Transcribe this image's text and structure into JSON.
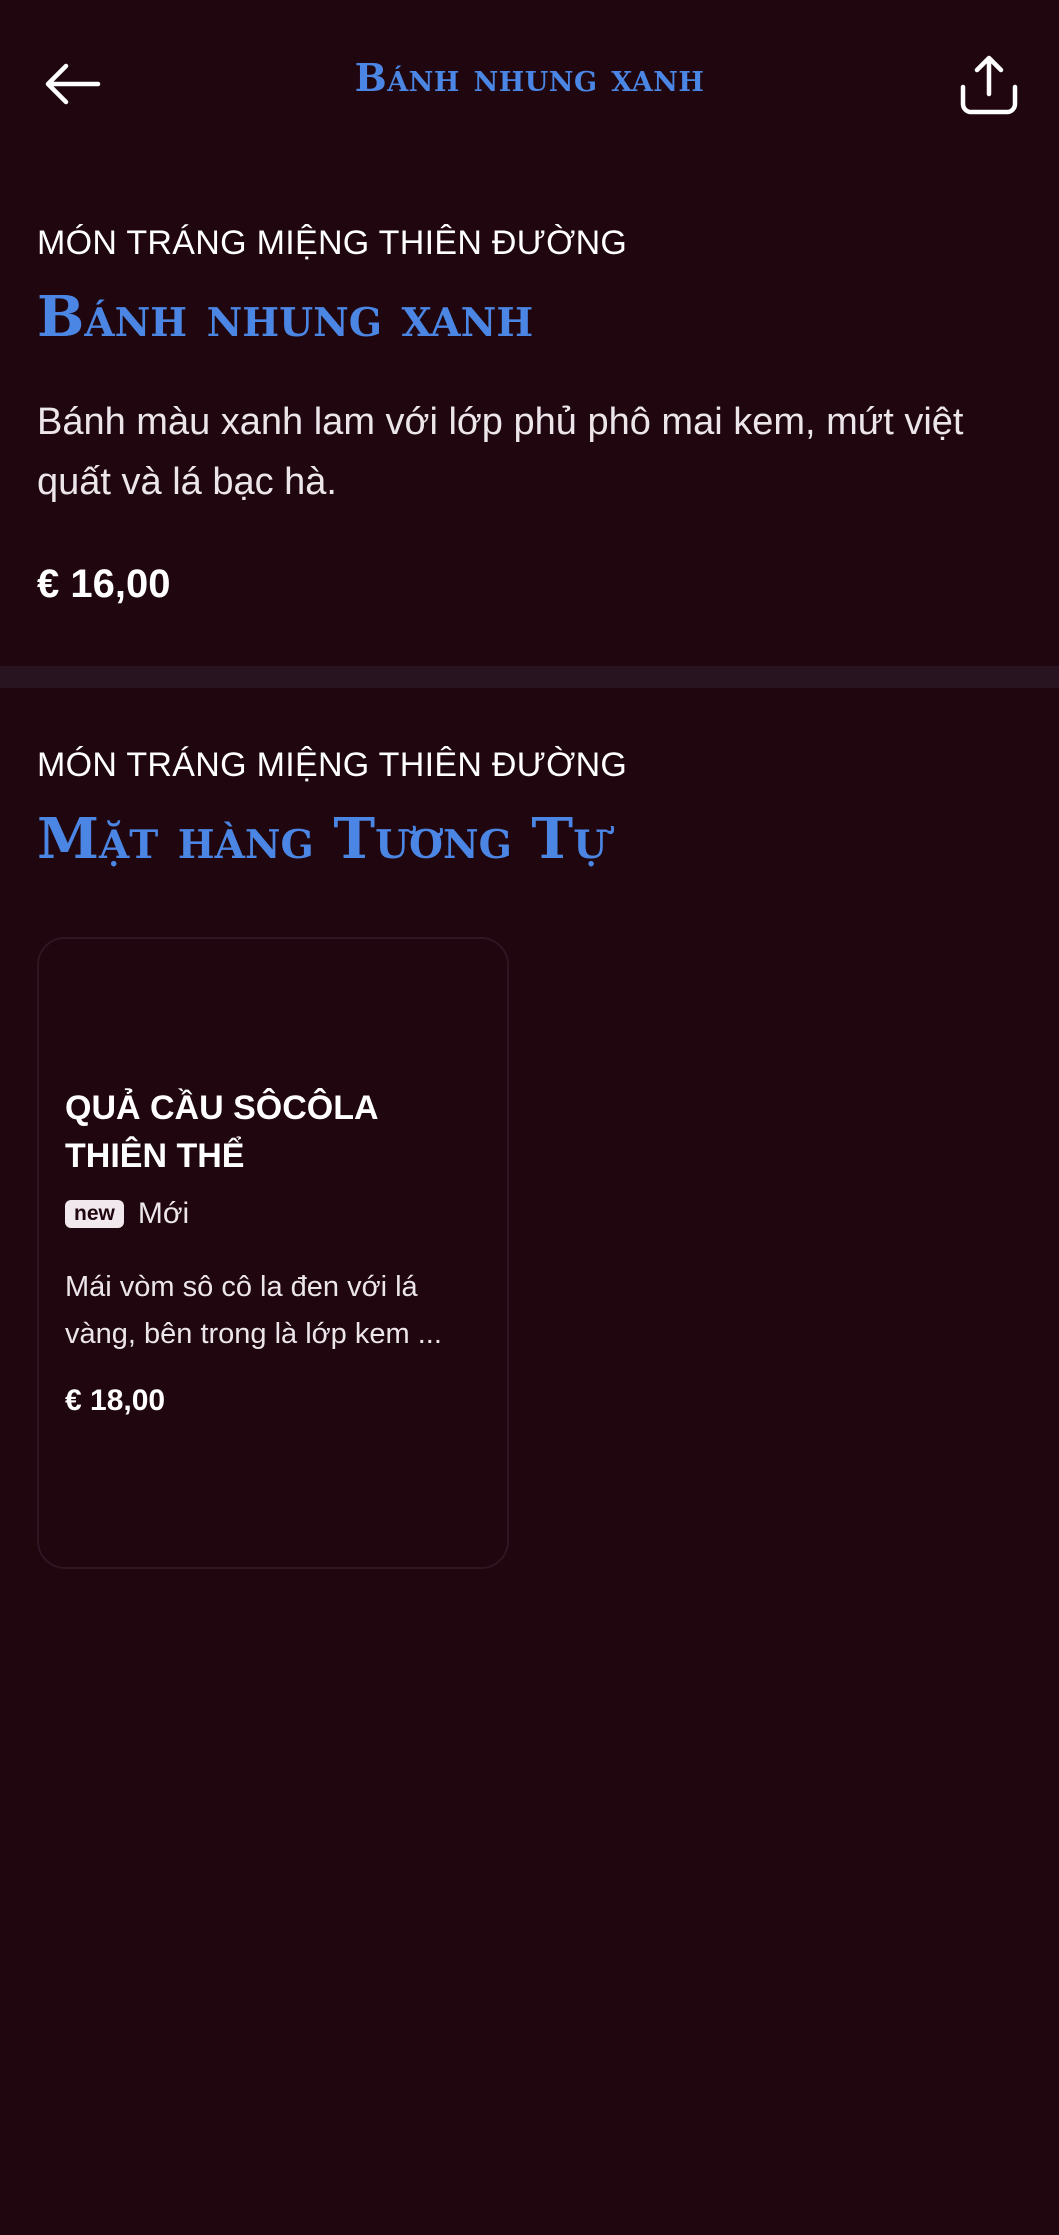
{
  "header": {
    "title": "Bánh nhung xanh"
  },
  "product": {
    "category": "MÓN TRÁNG MIỆNG THIÊN ĐƯỜNG",
    "name": "Bánh nhung xanh",
    "description": "Bánh màu xanh lam với lớp phủ phô mai kem, mứt việt quất và lá bạc hà.",
    "price": "€ 16,00"
  },
  "similar": {
    "category": "MÓN TRÁNG MIỆNG THIÊN ĐƯỜNG",
    "title": "Mặt hàng Tương Tự",
    "items": [
      {
        "name": "QUẢ CẦU SÔCÔLA THIÊN THỂ",
        "badge": "new",
        "badge_label": "Mới",
        "description": "Mái vòm sô cô la đen với lá vàng, bên trong là lớp kem ...",
        "price": "€ 18,00"
      }
    ]
  },
  "colors": {
    "background": "#1f060f",
    "accent": "#4b86e4",
    "divider": "#281420"
  },
  "icons": {
    "back": "arrow-left-icon",
    "share": "share-icon"
  }
}
